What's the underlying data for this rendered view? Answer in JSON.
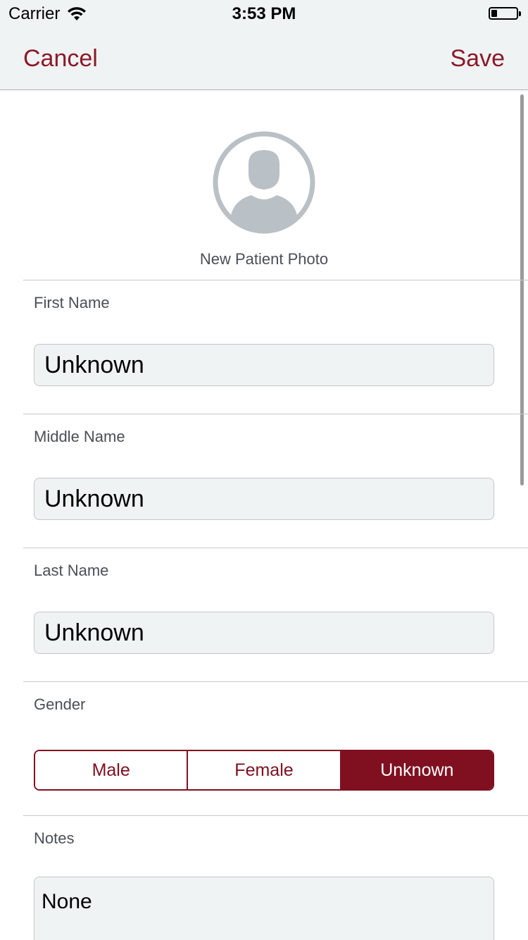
{
  "status_bar": {
    "carrier": "Carrier",
    "time": "3:53 PM",
    "wifi_icon": "wifi-icon",
    "battery_icon": "battery-icon"
  },
  "nav": {
    "cancel_label": "Cancel",
    "save_label": "Save"
  },
  "photo": {
    "icon": "person-avatar-icon",
    "label": "New Patient Photo"
  },
  "fields": {
    "first_name": {
      "label": "First Name",
      "value": "Unknown"
    },
    "middle_name": {
      "label": "Middle Name",
      "value": "Unknown"
    },
    "last_name": {
      "label": "Last Name",
      "value": "Unknown"
    },
    "gender": {
      "label": "Gender",
      "options": [
        "Male",
        "Female",
        "Unknown"
      ],
      "selected": "Unknown"
    },
    "notes": {
      "label": "Notes",
      "value": "None"
    }
  },
  "colors": {
    "accent": "#801020",
    "nav_background": "#f0f3f4",
    "input_background": "#f0f3f4",
    "label_text": "#4a4f57"
  }
}
